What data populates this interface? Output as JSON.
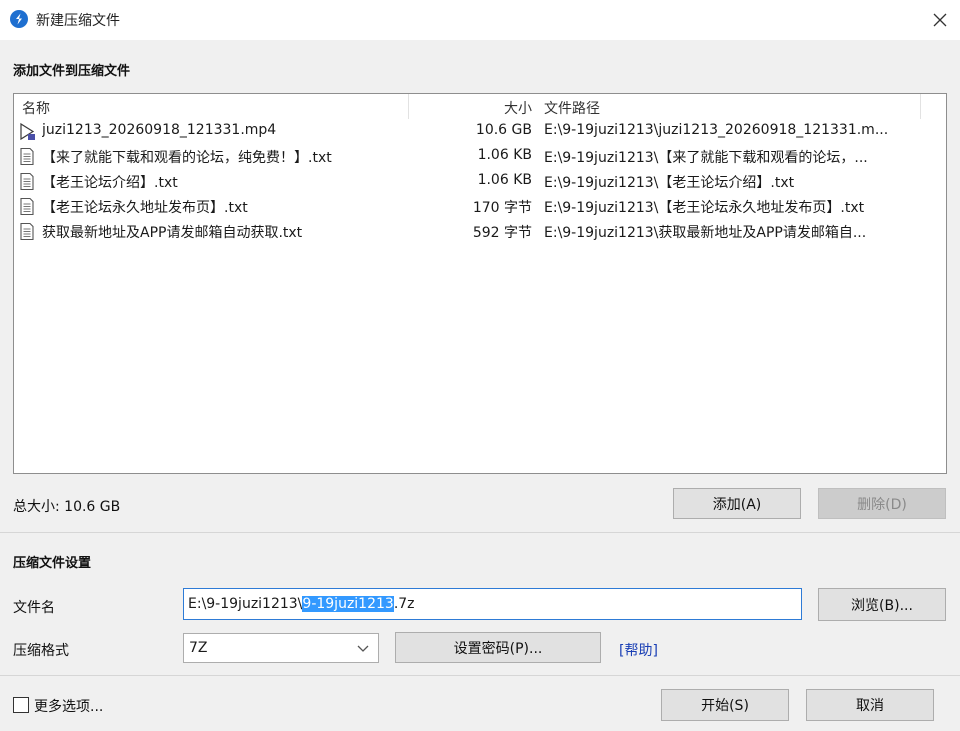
{
  "window": {
    "title": "新建压缩文件",
    "close_label": "✕"
  },
  "add_section": {
    "title": "添加文件到压缩文件",
    "columns": {
      "name": "名称",
      "size": "大小",
      "path": "文件路径"
    },
    "files": [
      {
        "icon": "video-file-icon",
        "name": "juzi1213_20260918_121331.mp4",
        "size": "10.6 GB",
        "path": "E:\\9-19juzi1213\\juzi1213_20260918_121331.m..."
      },
      {
        "icon": "text-file-icon",
        "name": "【来了就能下载和观看的论坛，纯免费！】.txt",
        "size": "1.06 KB",
        "path": "E:\\9-19juzi1213\\【来了就能下载和观看的论坛，..."
      },
      {
        "icon": "text-file-icon",
        "name": "【老王论坛介绍】.txt",
        "size": "1.06 KB",
        "path": "E:\\9-19juzi1213\\【老王论坛介绍】.txt"
      },
      {
        "icon": "text-file-icon",
        "name": "【老王论坛永久地址发布页】.txt",
        "size": "170 字节",
        "path": "E:\\9-19juzi1213\\【老王论坛永久地址发布页】.txt"
      },
      {
        "icon": "text-file-icon",
        "name": "获取最新地址及APP请发邮箱自动获取.txt",
        "size": "592 字节",
        "path": "E:\\9-19juzi1213\\获取最新地址及APP请发邮箱自..."
      }
    ],
    "total_size": "总大小: 10.6 GB",
    "add_button": "添加(A)",
    "delete_button": "删除(D)"
  },
  "settings": {
    "title": "压缩文件设置",
    "filename_label": "文件名",
    "filename_prefix": "E:\\9-19juzi1213\\",
    "filename_selected": "9-19juzi1213",
    "filename_suffix": ".7z",
    "browse_button": "浏览(B)...",
    "format_label": "压缩格式",
    "format_value": "7Z",
    "password_button": "设置密码(P)...",
    "help_link": "[帮助]"
  },
  "footer": {
    "more_options": "更多选项...",
    "start_button": "开始(S)",
    "cancel_button": "取消"
  },
  "colors": {
    "accent": "#1e6fd0",
    "selection": "#3399ff",
    "dialog_bg": "#f0f0f0",
    "link": "#1a3fb5"
  }
}
